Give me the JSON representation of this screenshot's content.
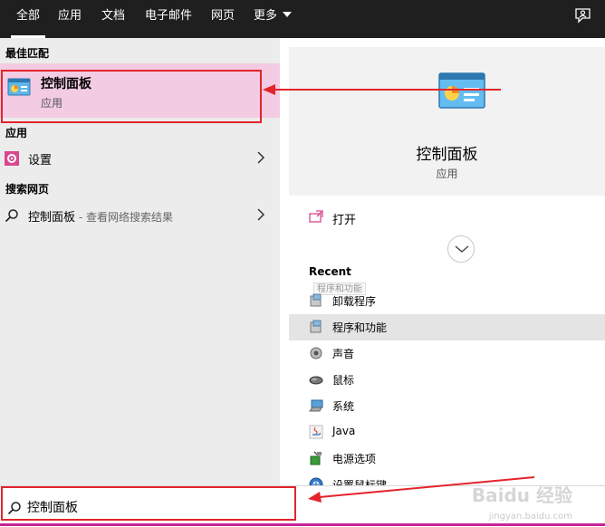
{
  "tabs": [
    {
      "label": "全部",
      "active": true
    },
    {
      "label": "应用"
    },
    {
      "label": "文档"
    },
    {
      "label": "电子邮件"
    },
    {
      "label": "网页"
    },
    {
      "label": "更多"
    }
  ],
  "left": {
    "best_match_heading": "最佳匹配",
    "best_match": {
      "title": "控制面板",
      "subtitle": "应用",
      "icon": "control-panel-icon"
    },
    "apps_heading": "应用",
    "apps": [
      {
        "label": "设置",
        "icon": "gear-icon"
      }
    ],
    "web_heading": "搜索网页",
    "web": [
      {
        "label": "控制面板",
        "hint": " - 查看网络搜索结果",
        "icon": "search-icon"
      }
    ]
  },
  "detail": {
    "title": "控制面板",
    "subtitle": "应用",
    "icon": "control-panel-icon",
    "action_open": "打开",
    "recent_heading": "Recent",
    "tooltip": "程序和功能",
    "recent": [
      {
        "label": "卸载程序",
        "icon": "programs-icon"
      },
      {
        "label": "程序和功能",
        "icon": "programs-icon",
        "selected": true
      },
      {
        "label": "声音",
        "icon": "speaker-icon"
      },
      {
        "label": "鼠标",
        "icon": "mouse-icon"
      },
      {
        "label": "系统",
        "icon": "computer-icon"
      },
      {
        "label": "Java",
        "icon": "java-icon"
      },
      {
        "label": "电源选项",
        "icon": "power-icon"
      },
      {
        "label": "设置鼠标键",
        "icon": "ease-of-access-icon"
      }
    ]
  },
  "search": {
    "value": "控制面板"
  },
  "watermark": {
    "brand": "Baidu 经验",
    "url": "jingyan.baidu.com"
  },
  "colors": {
    "highlight": "#f3cbe3",
    "annotation": "#e3242b",
    "accent": "#c5249a",
    "topbar": "#1f1f1f"
  }
}
